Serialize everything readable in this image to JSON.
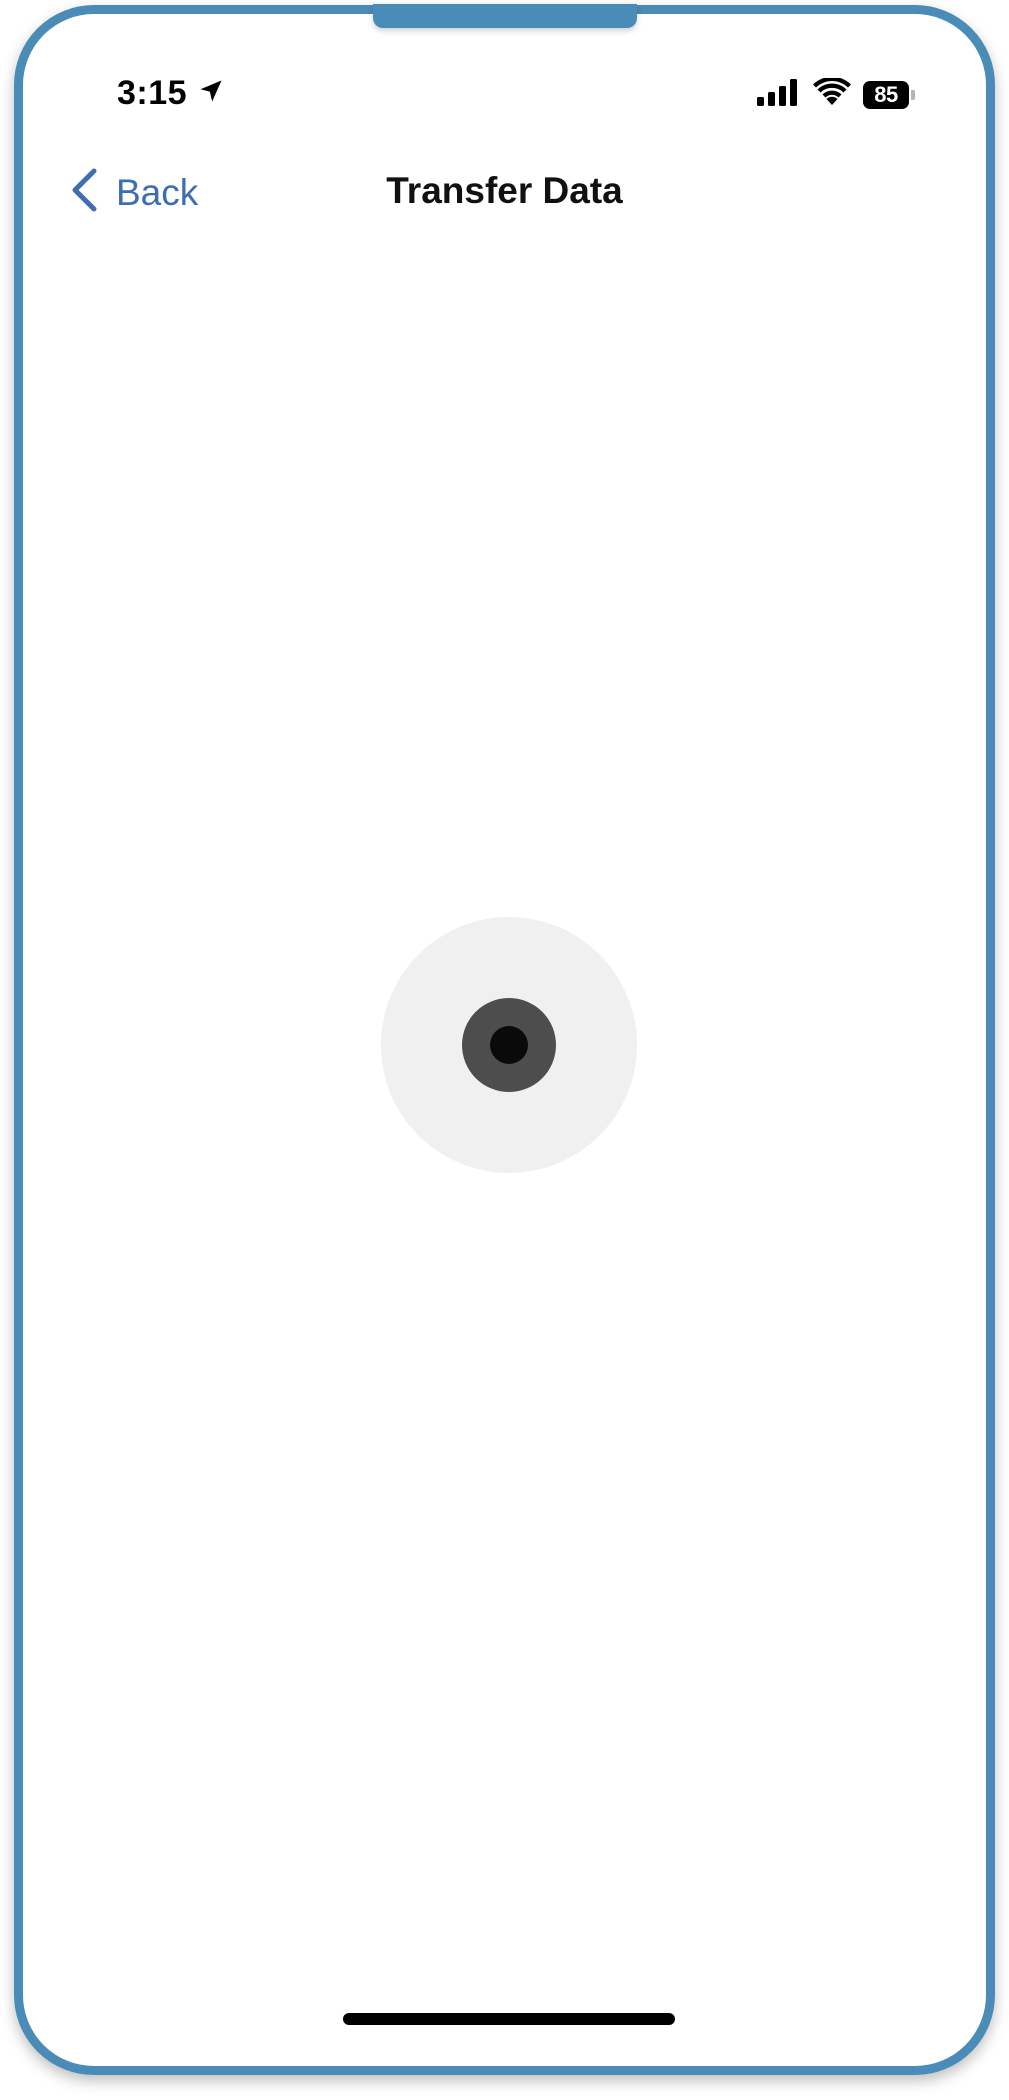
{
  "status_bar": {
    "time": "3:15",
    "battery_level": "85",
    "location_icon": "location-arrow-icon",
    "signal_icon": "cellular-signal-icon",
    "wifi_icon": "wifi-icon"
  },
  "nav": {
    "back_label": "Back",
    "back_icon": "chevron-left-icon",
    "title": "Transfer Data"
  },
  "colors": {
    "frame": "#4a8bb8",
    "accent": "#3e6eb0",
    "loader_outer": "#f0f0f0",
    "loader_mid": "#4d4d4d",
    "loader_core": "#0a0a0a"
  }
}
